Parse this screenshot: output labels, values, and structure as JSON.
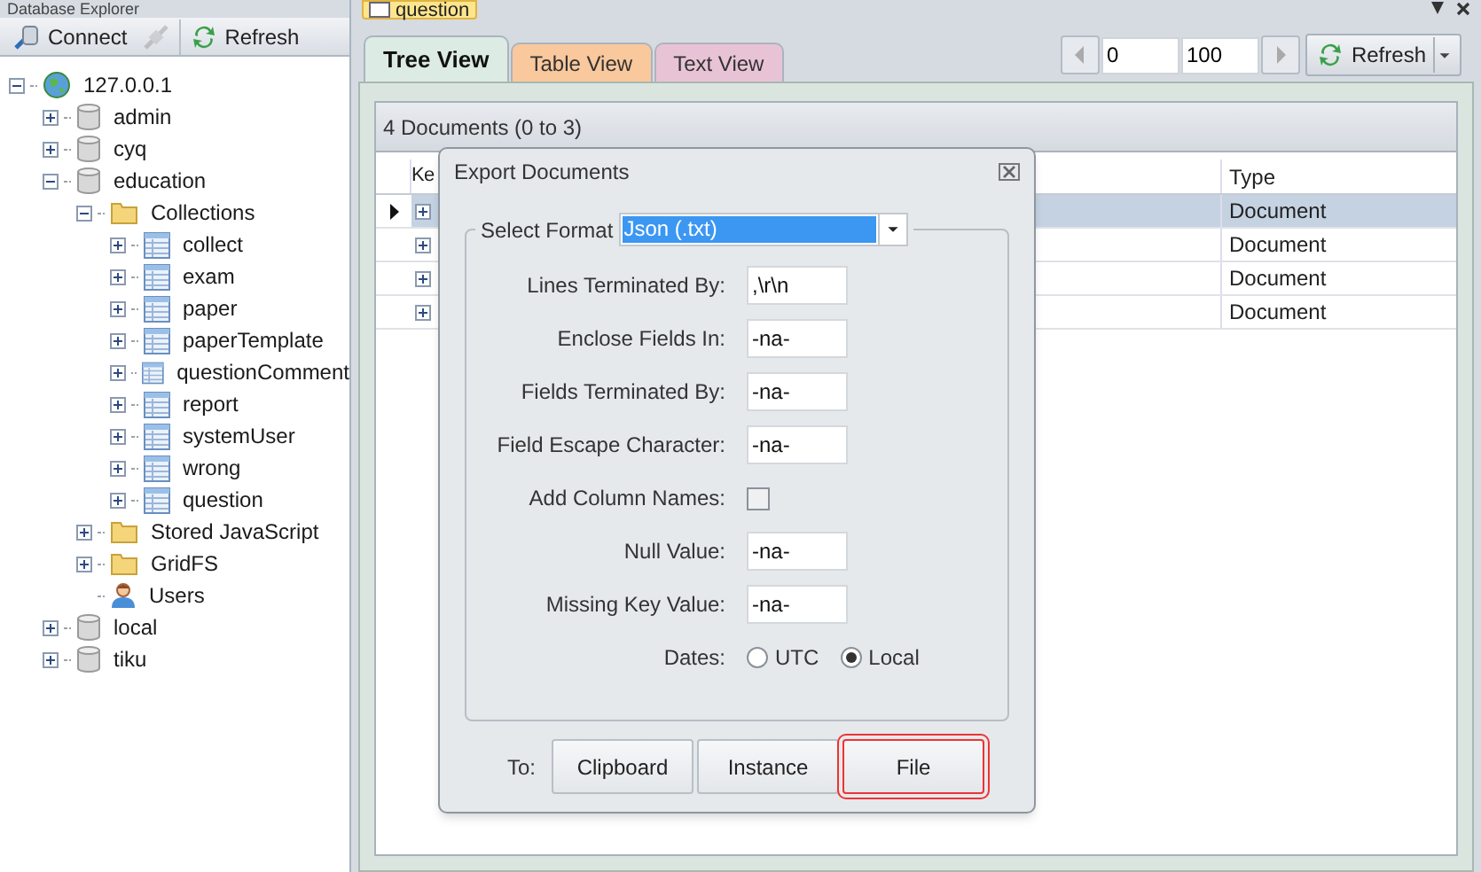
{
  "explorer": {
    "title": "Database Explorer",
    "toolbar": [
      {
        "label": "Connect",
        "kind": "connect",
        "disabled": false
      },
      {
        "kind": "disconnect",
        "disabled": true
      },
      {
        "label": "Refresh",
        "kind": "refresh",
        "disabled": false
      }
    ]
  },
  "tree": [
    {
      "label": "127.0.0.1",
      "kind": "server",
      "expanded": true,
      "children": [
        {
          "label": "admin",
          "kind": "database",
          "expanded": false
        },
        {
          "label": "cyq",
          "kind": "database",
          "expanded": false
        },
        {
          "label": "education",
          "kind": "database",
          "expanded": true,
          "children": [
            {
              "label": "Collections",
              "kind": "folder",
              "expanded": true,
              "children": [
                {
                  "label": "collect",
                  "kind": "collection",
                  "expanded": false
                },
                {
                  "label": "exam",
                  "kind": "collection",
                  "expanded": false
                },
                {
                  "label": "paper",
                  "kind": "collection",
                  "expanded": false
                },
                {
                  "label": "paperTemplate",
                  "kind": "collection",
                  "expanded": false
                },
                {
                  "label": "questionComment",
                  "kind": "collection",
                  "expanded": false
                },
                {
                  "label": "report",
                  "kind": "collection",
                  "expanded": false
                },
                {
                  "label": "systemUser",
                  "kind": "collection",
                  "expanded": false
                },
                {
                  "label": "wrong",
                  "kind": "collection",
                  "expanded": false
                },
                {
                  "label": "question",
                  "kind": "collection",
                  "expanded": false
                }
              ]
            },
            {
              "label": "Stored JavaScript",
              "kind": "folder",
              "expanded": false
            },
            {
              "label": "GridFS",
              "kind": "folder",
              "expanded": false
            },
            {
              "label": "Users",
              "kind": "users"
            }
          ]
        },
        {
          "label": "local",
          "kind": "database",
          "expanded": false
        },
        {
          "label": "tiku",
          "kind": "database",
          "expanded": false
        }
      ]
    }
  ],
  "document_tab": {
    "label": "question"
  },
  "view_tabs": [
    {
      "label": "Tree View",
      "selected": true,
      "color": "#dcebe3"
    },
    {
      "label": "Table View",
      "selected": false,
      "color": "#f9c89c"
    },
    {
      "label": "Text View",
      "selected": false,
      "color": "#e8c3d6"
    }
  ],
  "paging": {
    "start": "0",
    "count": "100",
    "refresh": "Refresh"
  },
  "grid": {
    "summary": "4 Documents (0 to 3)",
    "columns": [
      "Ke",
      "Type"
    ],
    "rows": [
      {
        "type": "Document",
        "selected": true
      },
      {
        "type": "Document",
        "selected": false
      },
      {
        "type": "Document",
        "selected": false
      },
      {
        "type": "Document",
        "selected": false
      }
    ]
  },
  "dialog": {
    "title": "Export Documents",
    "format_label": "Select Format",
    "format": "Json (.txt)",
    "fields": [
      {
        "kind": "text",
        "label": "Lines Terminated By:",
        "value": ",\\r\\n"
      },
      {
        "kind": "text",
        "label": "Enclose Fields In:",
        "value": "-na-"
      },
      {
        "kind": "text",
        "label": "Fields Terminated By:",
        "value": "-na-"
      },
      {
        "kind": "text",
        "label": "Field Escape Character:",
        "value": "-na-"
      },
      {
        "kind": "checkbox",
        "label": "Add Column Names:",
        "checked": false
      },
      {
        "kind": "text",
        "label": "Null Value:",
        "value": "-na-"
      },
      {
        "kind": "text",
        "label": "Missing Key Value:",
        "value": "-na-"
      },
      {
        "kind": "radio",
        "label": "Dates:",
        "options": [
          {
            "label": "UTC",
            "selected": false
          },
          {
            "label": "Local",
            "selected": true
          }
        ]
      }
    ],
    "to_label": "To:",
    "buttons": [
      {
        "label": "Clipboard",
        "highlighted": false
      },
      {
        "label": "Instance",
        "highlighted": false
      },
      {
        "label": "File",
        "highlighted": true
      }
    ]
  }
}
